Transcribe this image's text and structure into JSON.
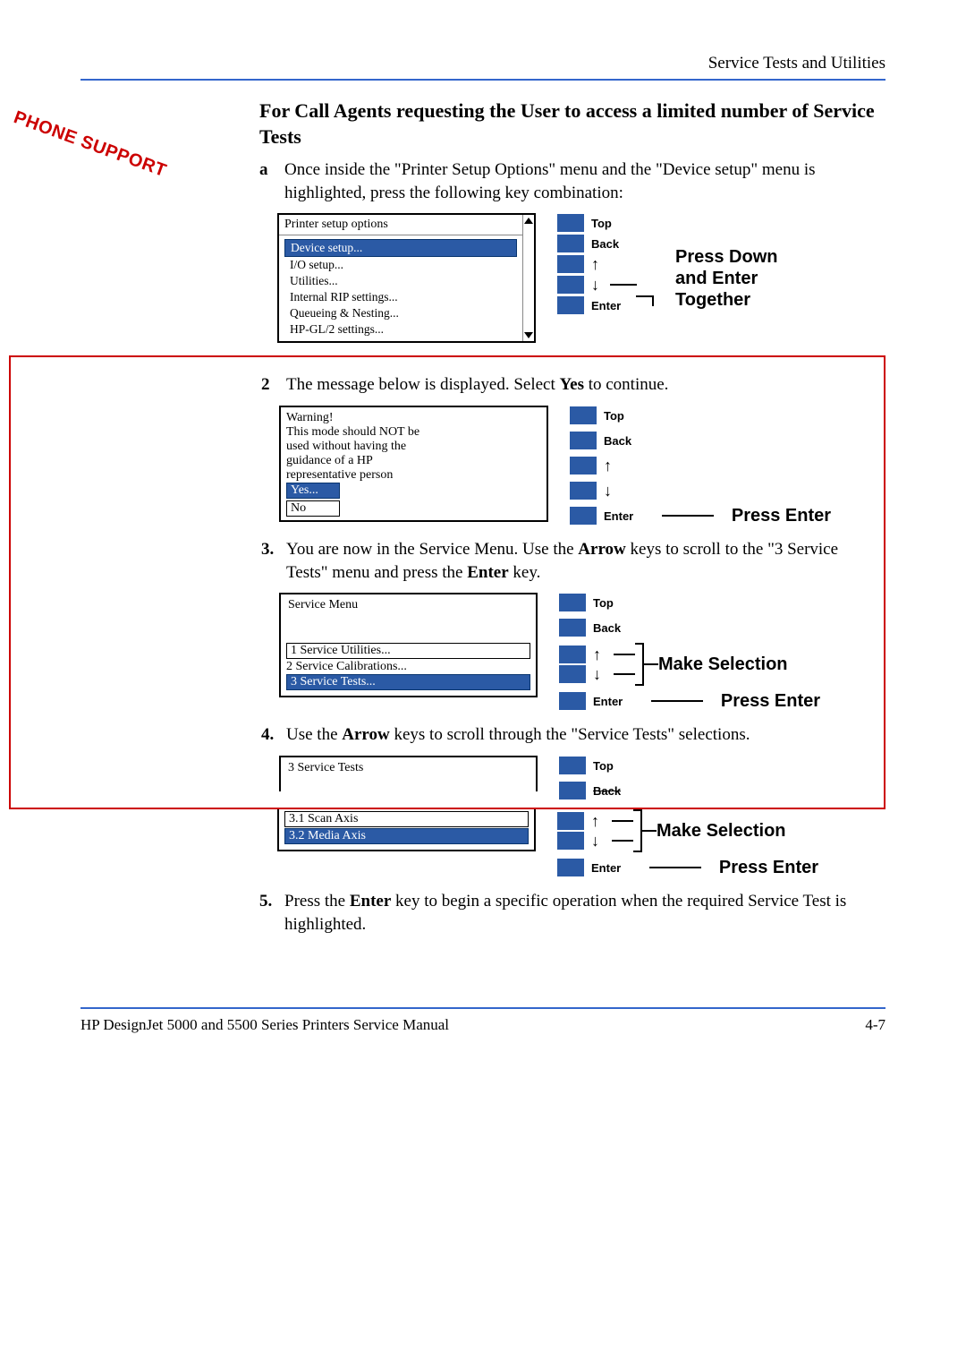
{
  "header": "Service Tests and Utilities",
  "watermark": "PHONE SUPPORT",
  "section_title": "For Call Agents requesting the User to access a limited number of Service Tests",
  "step_a": {
    "num": "a",
    "text_1": "Once inside the \"Printer Setup Options\" menu and the \"Device setup\" menu is highlighted, press the following key combination:"
  },
  "lcd1": {
    "title": "Printer setup options",
    "items": [
      "Device setup...",
      "I/O setup...",
      "Utilities...",
      "Internal RIP settings...",
      "Queueing & Nesting...",
      "HP-GL/2 settings..."
    ],
    "highlight_index": 0
  },
  "buttons": {
    "top": "Top",
    "back": "Back",
    "up": "↑",
    "down": "↓",
    "enter": "Enter"
  },
  "action_a": "Press Down and Enter Together",
  "step_2": {
    "num": "2",
    "pre": "The message below is displayed. Select ",
    "yes": "Yes",
    "post": " to continue."
  },
  "warning": {
    "l1": "Warning!",
    "l2": "This mode should NOT be",
    "l3": "used without having the",
    "l4": "guidance of a HP",
    "l5": "representative person",
    "yes": "Yes...",
    "no": "No"
  },
  "press_enter": "Press Enter",
  "make_selection": "Make Selection",
  "step_3": {
    "num": "3.",
    "pre": "You are now in the Service Menu. Use the ",
    "arrow": "Arrow",
    "mid": " keys to scroll to the \"3 Service Tests\" menu and press the ",
    "enter": "Enter",
    "post": " key."
  },
  "lcd3": {
    "title": "Service Menu",
    "items": [
      "1 Service Utilities...",
      "2 Service Calibrations...",
      "3 Service Tests..."
    ],
    "highlight_index": 2
  },
  "step_4": {
    "num": "4.",
    "pre": "Use the ",
    "arrow": "Arrow",
    "post": " keys to scroll through the \"Service Tests\" selections."
  },
  "lcd4": {
    "title": "3 Service Tests",
    "items": [
      "3.1 Scan Axis",
      "3.2 Media Axis"
    ],
    "highlight_index": 1
  },
  "step_5": {
    "num": "5.",
    "pre": "Press the ",
    "enter": "Enter",
    "post": " key to begin a specific operation when the required Service Test is highlighted."
  },
  "footer_left": "HP DesignJet 5000 and 5500 Series Printers Service Manual",
  "footer_right": "4-7"
}
